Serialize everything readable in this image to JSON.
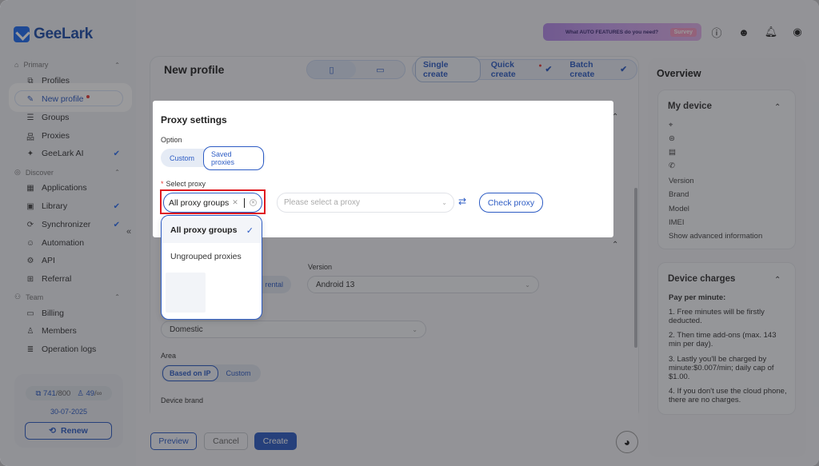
{
  "colors": {
    "accent": "#2d5cc4",
    "danger": "#e53935",
    "highlight_frame": "#e0191f",
    "traffic_red": "#f45b55",
    "traffic_yellow": "#f6bd2e",
    "traffic_green": "#34c748"
  },
  "app": {
    "name": "GeeLark"
  },
  "sidebar": {
    "sections": {
      "primary": "Primary",
      "discover": "Discover",
      "team": "Team"
    },
    "items": [
      {
        "label": "Profiles",
        "icon": "profiles-icon"
      },
      {
        "label": "New profile",
        "icon": "edit-icon"
      },
      {
        "label": "Groups",
        "icon": "list-icon"
      },
      {
        "label": "Proxies",
        "icon": "network-icon"
      },
      {
        "label": "GeeLark AI",
        "icon": "ai-icon"
      },
      {
        "label": "Applications",
        "icon": "grid-icon"
      },
      {
        "label": "Library",
        "icon": "library-icon"
      },
      {
        "label": "Synchronizer",
        "icon": "sync-icon"
      },
      {
        "label": "Automation",
        "icon": "robot-icon"
      },
      {
        "label": "API",
        "icon": "api-icon"
      },
      {
        "label": "Referral",
        "icon": "gift-icon"
      },
      {
        "label": "Billing",
        "icon": "billing-icon"
      },
      {
        "label": "Members",
        "icon": "user-icon"
      },
      {
        "label": "Operation logs",
        "icon": "logs-icon"
      }
    ],
    "usage": {
      "profiles_used": "741",
      "profiles_total": "/800",
      "members_used": "49",
      "members_total": "/∞",
      "date": "30-07-2025",
      "renew": "Renew"
    }
  },
  "topbar": {
    "banner_text": "What AUTO FEATURES do you need?",
    "banner_cta": "Survey"
  },
  "main": {
    "title": "New profile",
    "create_tabs": [
      "Single create",
      "Quick create",
      "Batch create"
    ],
    "behind": {
      "version_label": "Version",
      "version_value": "Android 13",
      "rental_partial": "rental",
      "region_value": "Domestic",
      "area_label": "Area",
      "area_options": [
        "Based on IP",
        "Custom"
      ],
      "device_brand_label": "Device brand"
    },
    "buttons": {
      "preview": "Preview",
      "cancel": "Cancel",
      "create": "Create"
    }
  },
  "overview": {
    "title": "Overview",
    "my_device": {
      "title": "My device",
      "fields": [
        "Version",
        "Brand",
        "Model",
        "IMEI",
        "Show advanced information"
      ]
    },
    "device_charges": {
      "title": "Device charges",
      "subtitle": "Pay per minute:",
      "lines": [
        "1. Free minutes will be firstly deducted.",
        "2. Then time add-ons (max. 143 min per day).",
        "3. Lastly you'll be charged by minute:$0.007/min; daily cap of $1.00.",
        "4. If you don't use the cloud phone, there are no charges."
      ]
    }
  },
  "modal": {
    "title": "Proxy settings",
    "option_label": "Option",
    "options": [
      "Custom",
      "Saved proxies"
    ],
    "select_proxy_label": "Select proxy",
    "required_mark": "*",
    "group_value": "All proxy groups",
    "proxy_placeholder": "Please select a proxy",
    "check_button": "Check proxy",
    "dropdown_items": [
      "All proxy groups",
      "Ungrouped proxies"
    ]
  }
}
